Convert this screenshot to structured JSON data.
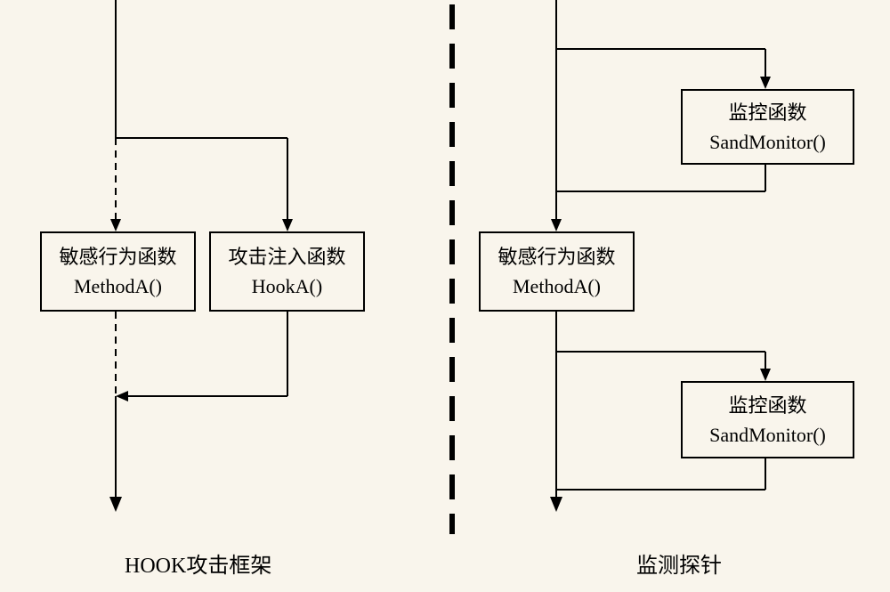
{
  "left": {
    "box1_line1": "敏感行为函数",
    "box1_line2": "MethodA()",
    "box2_line1": "攻击注入函数",
    "box2_line2": "HookA()",
    "caption": "HOOK攻击框架"
  },
  "right": {
    "box1_line1": "监控函数",
    "box1_line2": "SandMonitor()",
    "box2_line1": "敏感行为函数",
    "box2_line2": "MethodA()",
    "box3_line1": "监控函数",
    "box3_line2": "SandMonitor()",
    "caption": "监测探针"
  }
}
